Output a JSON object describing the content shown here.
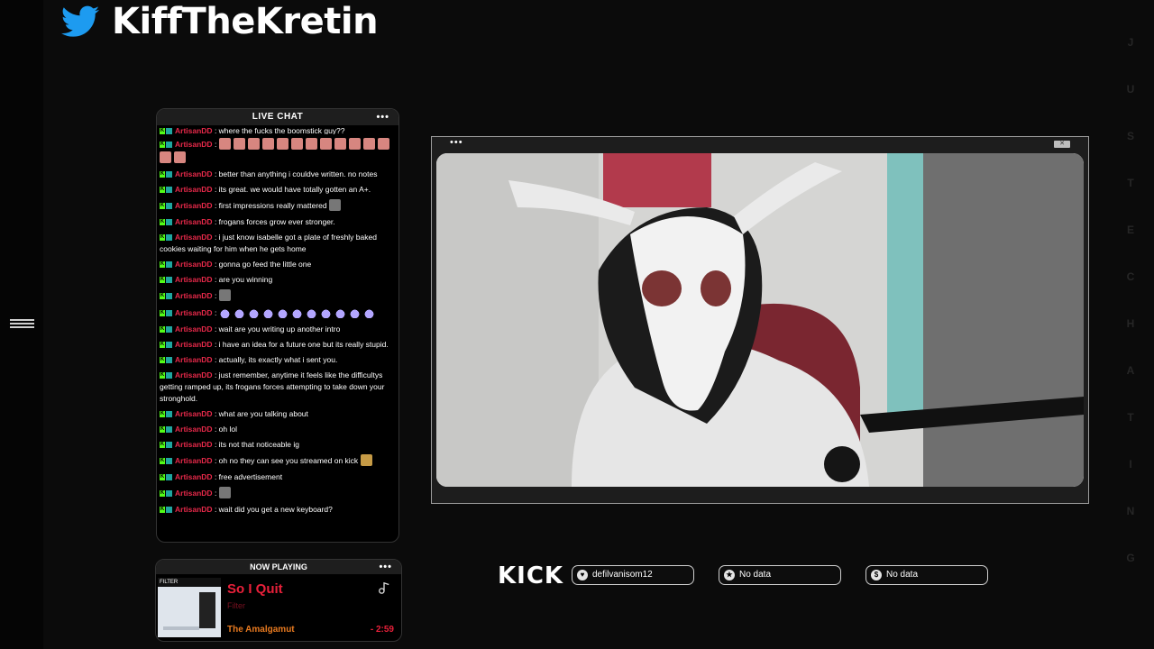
{
  "header": {
    "handle": "KiffTheKretin"
  },
  "side_letters": [
    "J",
    "U",
    "S",
    "T",
    "E",
    "C",
    "H",
    "A",
    "T",
    "I",
    "N",
    "G"
  ],
  "chat": {
    "title": "LIVE CHAT",
    "dots": "•••",
    "top_partial": {
      "user": "ArtisanDD",
      "text": ": where the fucks the boomstick guy??"
    },
    "messages": [
      {
        "user": "ArtisanDD",
        "text": ":",
        "emote": "pig",
        "emote_count": 14
      },
      {
        "user": "ArtisanDD",
        "text": ": better than anything i couldve written. no notes"
      },
      {
        "user": "ArtisanDD",
        "text": ": its great. we would have totally gotten an A+."
      },
      {
        "user": "ArtisanDD",
        "text": ": first impressions really mattered",
        "emote": "img",
        "emote_count": 1
      },
      {
        "user": "ArtisanDD",
        "text": ": frogans forces grow ever stronger."
      },
      {
        "user": "ArtisanDD",
        "text": ": i just know isabelle got a plate of freshly baked cookies waiting for him when he gets home"
      },
      {
        "user": "ArtisanDD",
        "text": ": gonna go feed the little one"
      },
      {
        "user": "ArtisanDD",
        "text": ": are you winning"
      },
      {
        "user": "ArtisanDD",
        "text": ":",
        "emote": "img",
        "emote_count": 1
      },
      {
        "user": "ArtisanDD",
        "text": ":",
        "emote": "drop",
        "emote_count": 11
      },
      {
        "user": "ArtisanDD",
        "text": ": wait are you writing up another intro"
      },
      {
        "user": "ArtisanDD",
        "text": ": i have an idea for a future one but its really stupid."
      },
      {
        "user": "ArtisanDD",
        "text": ": actually, its exactly what i sent you."
      },
      {
        "user": "ArtisanDD",
        "text": ": just remember, anytime it feels like the difficultys getting ramped up, its frogans forces attempting to take down your stronghold."
      },
      {
        "user": "ArtisanDD",
        "text": ": what are you talking about"
      },
      {
        "user": "ArtisanDD",
        "text": ": oh lol"
      },
      {
        "user": "ArtisanDD",
        "text": ": its not that noticeable ig"
      },
      {
        "user": "ArtisanDD",
        "text": ": oh no they can see you streamed on kick",
        "emote": "face",
        "emote_count": 1
      },
      {
        "user": "ArtisanDD",
        "text": ": free advertisement"
      },
      {
        "user": "ArtisanDD",
        "text": ":",
        "emote": "img",
        "emote_count": 1
      },
      {
        "user": "ArtisanDD",
        "text": ": wait did you get a new keyboard?"
      }
    ]
  },
  "now_playing": {
    "title": "NOW PLAYING",
    "dots": "•••",
    "album_band": "FILTER",
    "song": "So I Quit",
    "artist": "Filter",
    "album": "The Amalgamut",
    "time": "- 2:59"
  },
  "video": {
    "dots": "•••",
    "close": "✕"
  },
  "footer": {
    "platform": "KICK",
    "stats": [
      {
        "icon": "heart-icon",
        "glyph": "♥",
        "label": "defilvanisom12"
      },
      {
        "icon": "star-icon",
        "glyph": "★",
        "label": "No data"
      },
      {
        "icon": "dollar-icon",
        "glyph": "$",
        "label": "No data"
      }
    ]
  }
}
